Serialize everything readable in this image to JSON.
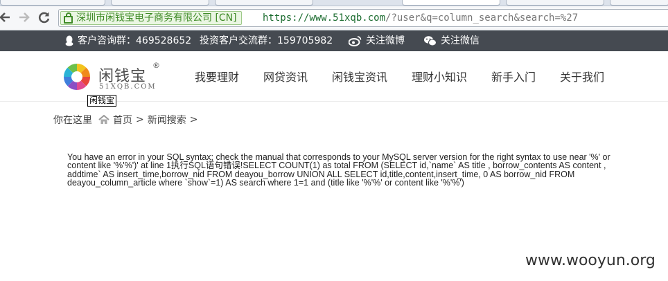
{
  "browser": {
    "cert_label": "深圳市闲钱宝电子商务有限公司 [CN]",
    "url_scheme_host": "https://www.51xqb.com",
    "url_rest": "/?user&q=column_search&search=%27",
    "back_icon": "back-arrow-icon",
    "forward_icon": "forward-arrow-icon",
    "reload_icon": "reload-icon"
  },
  "topbar": {
    "qq_group": "客户咨询群：469528652",
    "investor_group": "投资客户交流群：159705982",
    "weibo": "关注微博",
    "wechat": "关注微信",
    "bg_color": "#454a51"
  },
  "logo": {
    "name": "闲钱宝",
    "reg": "®",
    "sub": "51XQB.COM",
    "tooltip": "闲钱宝"
  },
  "menu": [
    "我要理财",
    "网贷资讯",
    "闲钱宝资讯",
    "理财小知识",
    "新手入门",
    "关于我们"
  ],
  "breadcrumb": {
    "label": "你在这里",
    "home": "首页",
    "sep1": ">",
    "current": "新闻搜索",
    "sep2": ">"
  },
  "error_message": "You have an error in your SQL syntax; check the manual that corresponds to your MySQL server version for the right syntax to use near '%' or content like '%'%')' at line 1执行SQL语句错误!SELECT COUNT(1) as total FROM (SELECT id,`name` AS title , borrow_contents AS content , addtime` AS insert_time,borrow_nid FROM deayou_borrow UNION ALL SELECT id,title,content,insert_time, 0 AS borrow_nid FROM deayou_column_article where `show`=1) AS search where 1=1 and (title like '%'%' or content like '%'%')",
  "watermark": "www.wooyun.org"
}
